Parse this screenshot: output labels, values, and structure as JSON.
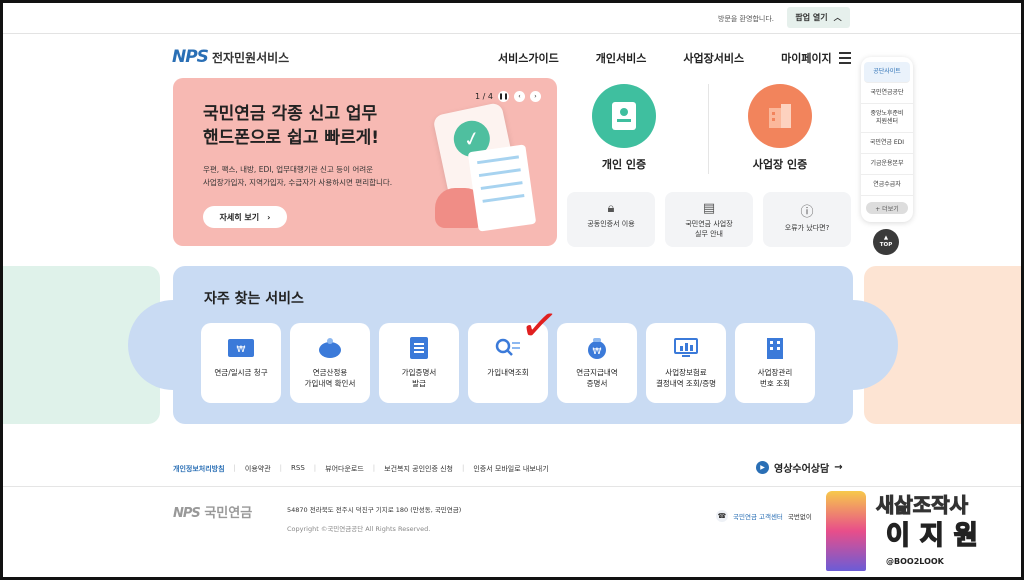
{
  "topbar": {
    "welcome": "방문을 환영합니다.",
    "popup_label": "팝업 열기",
    "popup_icon": "chevron-up"
  },
  "header": {
    "logo_mark": "NPS",
    "logo_text": "전자민원서비스",
    "nav": [
      "서비스가이드",
      "개인서비스",
      "사업장서비스",
      "마이페이지"
    ]
  },
  "banner": {
    "title_line1": "국민연금 각종 신고 업무",
    "title_line2": "핸드폰으로 쉽고 빠르게!",
    "desc_line1": "우편, 팩스, 내방, EDI, 업무대행기관 신고 등이 어려운",
    "desc_line2": "사업장가입자, 지역가입자, 수급자가 사용하시면 편리합니다.",
    "detail_label": "자세히 보기",
    "page_indicator": "1 / 4",
    "bg_color": "#f7b9b3"
  },
  "auth": {
    "personal_label": "개인 인증",
    "personal_color": "#3fbf9f",
    "business_label": "사업장 인증",
    "business_color": "#f2845c"
  },
  "quick_links": [
    {
      "label1": "공동인증서 이용",
      "label2": "",
      "icon": "lock-icon"
    },
    {
      "label1": "국민연금 사업장",
      "label2": "실무 안내",
      "icon": "document-icon"
    },
    {
      "label1": "오류가 났다면?",
      "label2": "",
      "icon": "alert-icon"
    }
  ],
  "rail": {
    "items": [
      "공단사이트",
      "국민연금공단",
      "중앙노후준비",
      "지원센터",
      "국민연금 EDI",
      "기금운용본부",
      "연금수급자"
    ],
    "more_label": "+ 더보기",
    "top_label": "TOP"
  },
  "services": {
    "title": "자주 찾는 서비스",
    "items": [
      {
        "l1": "연금/일시금 청구",
        "l2": "",
        "icon": "won-card-icon"
      },
      {
        "l1": "연금산정용",
        "l2": "가입내역 확인서",
        "icon": "piggy-bank-icon"
      },
      {
        "l1": "가입증명서",
        "l2": "발급",
        "icon": "document-list-icon"
      },
      {
        "l1": "가입내역조회",
        "l2": "",
        "icon": "search-list-icon"
      },
      {
        "l1": "연금지급내역",
        "l2": "증명서",
        "icon": "money-bag-icon"
      },
      {
        "l1": "사업장보험료",
        "l2": "결정내역 조회/증명",
        "icon": "monitor-chart-icon"
      },
      {
        "l1": "사업장관리",
        "l2": "번호 조회",
        "icon": "building-icon"
      }
    ]
  },
  "footer": {
    "links": [
      "개인정보처리방침",
      "이용약관",
      "RSS",
      "뷰어다운로드",
      "보건복지 공인인증 신청",
      "인증서 모바일로 내보내기"
    ],
    "video_label": "영상수어상담",
    "logo_mark": "NPS",
    "logo_text": "국민연금",
    "address": "54870 전라북도 전주시 덕진구 기지로 180 (만성동, 국민연금)",
    "copyright": "Copyright ©국민연금공단 All Rights Reserved.",
    "callcenter": "국민연금 고객센터",
    "callcenter_extra": "국번없이"
  },
  "watermark": {
    "title": "새삶조작사",
    "name": "이지원",
    "handle": "@BOO2LOOK"
  }
}
